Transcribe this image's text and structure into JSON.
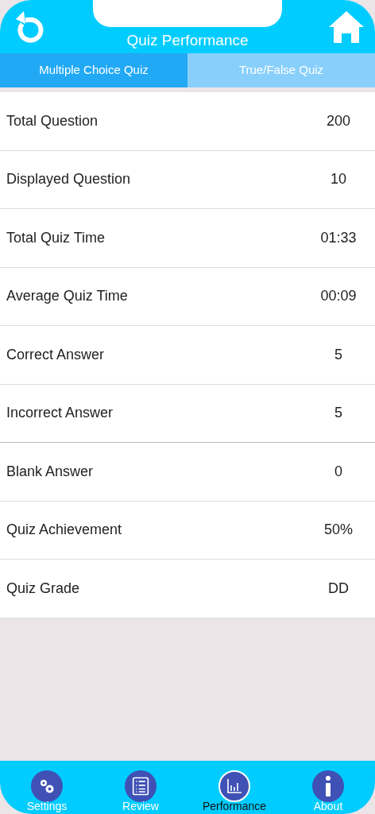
{
  "header": {
    "title": "Quiz Performance"
  },
  "tabs": [
    {
      "label": "Multiple Choice Quiz",
      "selected": true
    },
    {
      "label": "True/False Quiz",
      "selected": false
    }
  ],
  "stats": [
    {
      "label": "Total Question",
      "value": "200"
    },
    {
      "label": "Displayed Question",
      "value": "10"
    },
    {
      "label": "Total Quiz Time",
      "value": "01:33"
    },
    {
      "label": "Average Quiz Time",
      "value": "00:09"
    },
    {
      "label": "Correct Answer",
      "value": "5"
    },
    {
      "label": "Incorrect Answer",
      "value": "5"
    },
    {
      "label": "Blank Answer",
      "value": "0"
    },
    {
      "label": "Quiz Achievement",
      "value": "50%"
    },
    {
      "label": "Quiz Grade",
      "value": "DD"
    }
  ],
  "tab_bar": [
    {
      "kind": "settings",
      "label": "Settings",
      "selected": false
    },
    {
      "kind": "review",
      "label": "Review",
      "selected": false
    },
    {
      "kind": "performance",
      "label": "Performance",
      "selected": true
    },
    {
      "kind": "about",
      "label": "About",
      "selected": false
    }
  ]
}
